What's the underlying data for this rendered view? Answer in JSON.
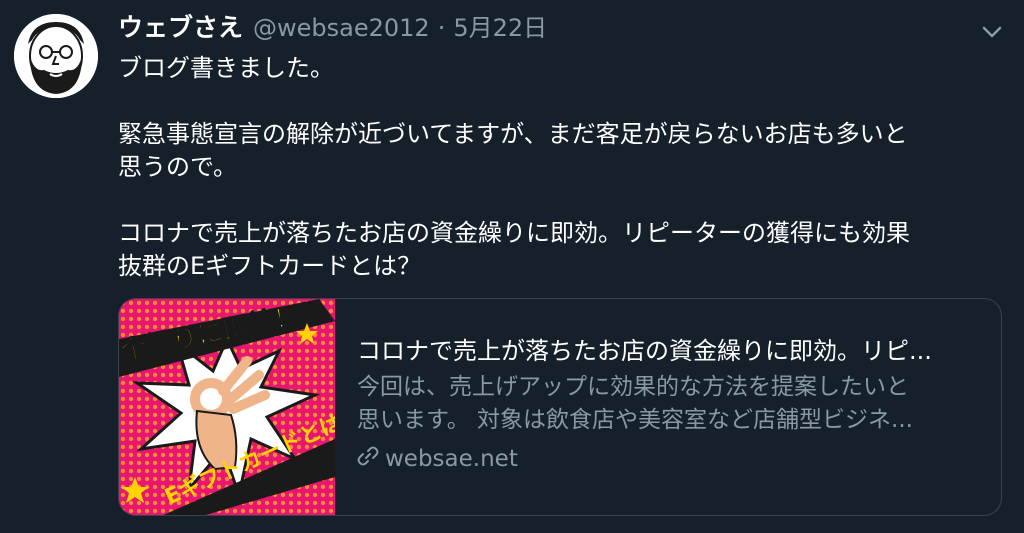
{
  "tweet": {
    "author_name": "ウェブさえ",
    "handle": "@websae2012",
    "separator": "·",
    "date": "5月22日",
    "lines": [
      "ブログ書きました。",
      "",
      "緊急事態宣言の解除が近づいてますが、まだ客足が戻らないお店も多いと",
      "思うので。",
      "",
      "コロナで売上が落ちたお店の資金繰りに即効。リピーターの獲得にも効果",
      "抜群のEギフトカードとは？"
    ]
  },
  "card": {
    "title": "コロナで売上が落ちたお店の資金繰りに即効。リピ...",
    "description_line1": "今回は、売上げアップに効果的な方法を提案したいと",
    "description_line2": "思います。 対象は飲食店や美容室など店舗型ビジネ...",
    "domain": "websae.net",
    "image_text_top": "金繰りに即効！",
    "image_text_bottom": "Eギフトカードとは"
  },
  "colors": {
    "background": "#15202b",
    "secondary_text": "#8899a6",
    "card_border": "#38444d",
    "image_pink": "#e8166e",
    "image_yellow": "#ffd400"
  },
  "icons": [
    "avatar-illustration",
    "chevron-down-icon",
    "link-icon"
  ]
}
